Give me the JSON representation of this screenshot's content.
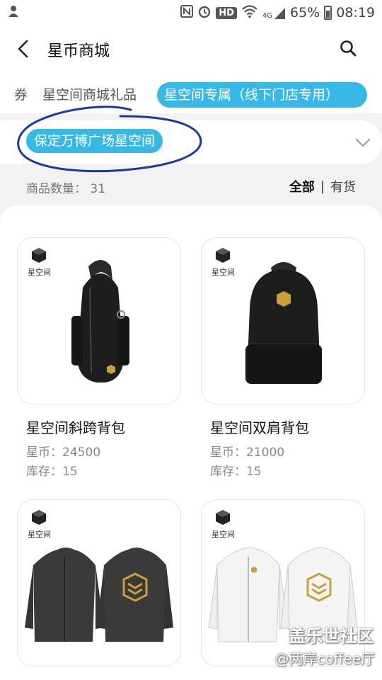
{
  "status_bar": {
    "battery": "65%",
    "time": "08:19",
    "network": "4G",
    "hd_label": "HD",
    "icons": [
      "nfc-icon",
      "alarm-icon",
      "wifi-icon",
      "signal-icon",
      "battery-icon"
    ]
  },
  "header": {
    "title": "星币商城",
    "back_icon": "chevron-left-icon",
    "search_icon": "search-icon"
  },
  "tabs": [
    {
      "label": "券",
      "active": false
    },
    {
      "label": "星空间商城礼品",
      "active": false
    },
    {
      "label": "星空间专属（线下门店专用）",
      "active": true
    }
  ],
  "store": {
    "selected": "保定万博广场星空间",
    "dropdown_icon": "chevron-down-icon"
  },
  "list": {
    "count_label": "商品数量：",
    "count_value": "31",
    "filter_all": "全部",
    "filter_in_stock": "有货"
  },
  "products": [
    {
      "name": "星空间斜跨背包",
      "price_label": "星币：",
      "price": "24500",
      "stock_label": "库存：",
      "stock": "15",
      "brand": "星空间"
    },
    {
      "name": "星空间双肩背包",
      "price_label": "星币：",
      "price": "21000",
      "stock_label": "库存：",
      "stock": "15",
      "brand": "星空间"
    },
    {
      "name": "",
      "brand": "星空间"
    },
    {
      "name": "",
      "brand": "星空间"
    }
  ],
  "watermark": {
    "line1": "盖乐世社区",
    "line2": "@两岸coffee厅"
  },
  "colors": {
    "accent": "#37b8e6",
    "scribble": "#1a3aa0"
  }
}
